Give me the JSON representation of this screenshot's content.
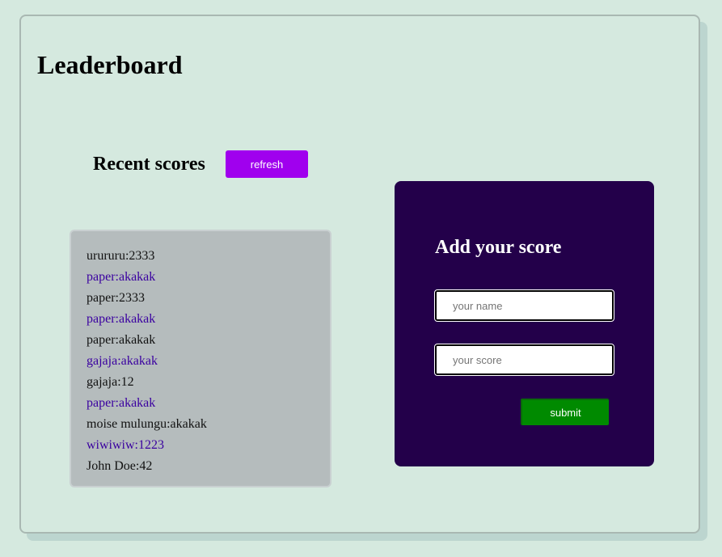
{
  "header": {
    "title": "Leaderboard"
  },
  "recent": {
    "heading": "Recent scores",
    "refresh_label": "refresh"
  },
  "scores": [
    "urururu:2333",
    "paper:akakak",
    "paper:2333",
    "paper:akakak",
    "paper:akakak",
    "gajaja:akakak",
    "gajaja:12",
    "paper:akakak",
    "moise mulungu:akakak",
    "wiwiwiw:1223",
    "John Doe:42"
  ],
  "form": {
    "title": "Add your score",
    "name_placeholder": "your name",
    "name_value": "",
    "score_placeholder": "your score",
    "score_value": "",
    "submit_label": "submit"
  },
  "colors": {
    "background": "#d5e9df",
    "refresh_button": "#a000ee",
    "list_background": "#b5bcbd",
    "list_alt_text": "#3a00a0",
    "form_panel": "#23004a",
    "submit_button": "#008a00"
  }
}
